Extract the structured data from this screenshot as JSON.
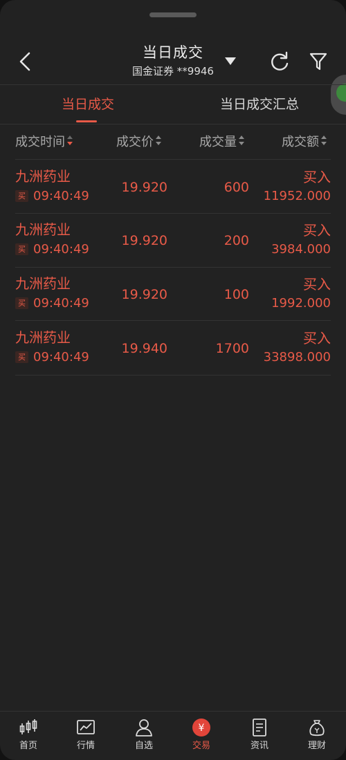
{
  "header": {
    "title": "当日成交",
    "account": "国金证券 **9946"
  },
  "tabs": [
    {
      "label": "当日成交",
      "active": true
    },
    {
      "label": "当日成交汇总",
      "active": false
    }
  ],
  "columns": [
    "成交时间",
    "成交价",
    "成交量",
    "成交额"
  ],
  "rows": [
    {
      "name": "九洲药业",
      "badge": "买",
      "time": "09:40:49",
      "price": "19.920",
      "qty": "600",
      "direction": "买入",
      "amount": "11952.000"
    },
    {
      "name": "九洲药业",
      "badge": "买",
      "time": "09:40:49",
      "price": "19.920",
      "qty": "200",
      "direction": "买入",
      "amount": "3984.000"
    },
    {
      "name": "九洲药业",
      "badge": "买",
      "time": "09:40:49",
      "price": "19.920",
      "qty": "100",
      "direction": "买入",
      "amount": "1992.000"
    },
    {
      "name": "九洲药业",
      "badge": "买",
      "time": "09:40:49",
      "price": "19.940",
      "qty": "1700",
      "direction": "买入",
      "amount": "33898.000"
    }
  ],
  "nav": [
    {
      "label": "首页",
      "icon": "candlestick-icon"
    },
    {
      "label": "行情",
      "icon": "chart-icon"
    },
    {
      "label": "自选",
      "icon": "user-icon"
    },
    {
      "label": "交易",
      "icon": "yen-icon",
      "active": true
    },
    {
      "label": "资讯",
      "icon": "document-icon"
    },
    {
      "label": "理财",
      "icon": "money-bag-icon"
    }
  ],
  "colors": {
    "background": "#222222",
    "accent": "#e85a48",
    "text": "#d8d8d8",
    "muted": "#a8a8a8"
  }
}
